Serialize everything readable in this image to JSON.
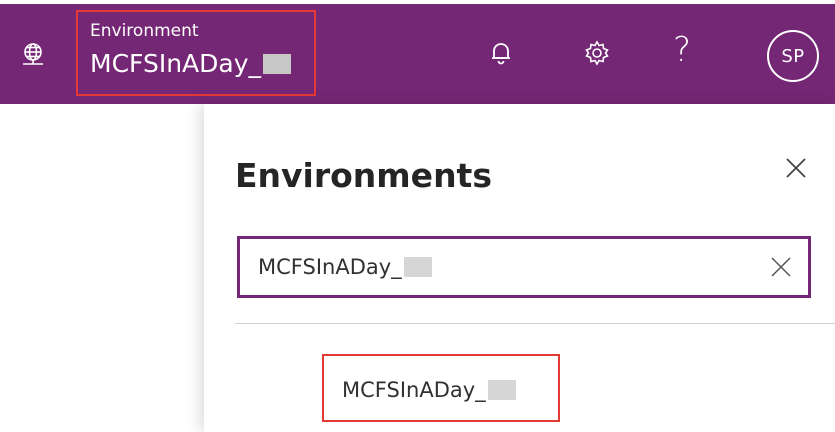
{
  "header": {
    "environment_caption": "Environment",
    "environment_name": "MCFSInADay_",
    "help_glyph": "?",
    "avatar_initials": "SP",
    "background_color": "#742774",
    "icons": [
      "globe-icon",
      "bell-icon",
      "gear-icon",
      "help-icon"
    ]
  },
  "panel": {
    "title": "Environments",
    "close_icon": "close-icon",
    "search": {
      "value": "MCFSInADay_",
      "clear_icon": "clear-icon"
    },
    "results": [
      {
        "label": "MCFSInADay_"
      }
    ]
  },
  "highlight_color": "#e53935"
}
